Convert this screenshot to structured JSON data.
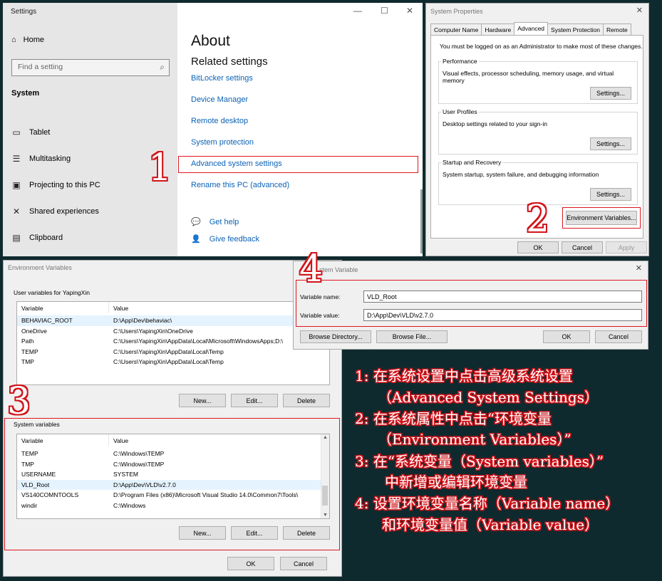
{
  "settings": {
    "window_title": "Settings",
    "home": "Home",
    "search_placeholder": "Find a setting",
    "section": "System",
    "nav": [
      "Tablet",
      "Multitasking",
      "Projecting to this PC",
      "Shared experiences",
      "Clipboard"
    ],
    "page_title": "About",
    "related_title": "Related settings",
    "links": [
      "BitLocker settings",
      "Device Manager",
      "Remote desktop",
      "System protection",
      "Advanced system settings",
      "Rename this PC (advanced)"
    ],
    "help": "Get help",
    "feedback": "Give feedback"
  },
  "system_properties": {
    "title": "System Properties",
    "tabs": [
      "Computer Name",
      "Hardware",
      "Advanced",
      "System Protection",
      "Remote"
    ],
    "active_tab": "Advanced",
    "note": "You must be logged on as an Administrator to make most of these changes.",
    "performance": {
      "title": "Performance",
      "desc": "Visual effects, processor scheduling, memory usage, and virtual memory",
      "button": "Settings..."
    },
    "user_profiles": {
      "title": "User Profiles",
      "desc": "Desktop settings related to your sign-in",
      "button": "Settings..."
    },
    "startup": {
      "title": "Startup and Recovery",
      "desc": "System startup, system failure, and debugging information",
      "button": "Settings..."
    },
    "env_button": "Environment Variables...",
    "ok": "OK",
    "cancel": "Cancel",
    "apply": "Apply"
  },
  "environment_variables": {
    "title": "Environment Variables",
    "user_label": "User variables for YapingXin",
    "col_variable": "Variable",
    "col_value": "Value",
    "user_vars": [
      {
        "name": "BEHAVIAC_ROOT",
        "value": "D:\\App\\Dev\\behaviac\\"
      },
      {
        "name": "OneDrive",
        "value": "C:\\Users\\YapingXin\\OneDrive"
      },
      {
        "name": "Path",
        "value": "C:\\Users\\YapingXin\\AppData\\Local\\Microsoft\\WindowsApps;D:\\"
      },
      {
        "name": "TEMP",
        "value": "C:\\Users\\YapingXin\\AppData\\Local\\Temp"
      },
      {
        "name": "TMP",
        "value": "C:\\Users\\YapingXin\\AppData\\Local\\Temp"
      }
    ],
    "system_label": "System variables",
    "system_vars": [
      {
        "name": "TEMP",
        "value": "C:\\Windows\\TEMP"
      },
      {
        "name": "TMP",
        "value": "C:\\Windows\\TEMP"
      },
      {
        "name": "USERNAME",
        "value": "SYSTEM"
      },
      {
        "name": "VLD_Root",
        "value": "D:\\App\\Dev\\VLD\\v2.7.0"
      },
      {
        "name": "VS140COMNTOOLS",
        "value": "D:\\Program Files (x86)\\Microsoft Visual Studio 14.0\\Common7\\Tools\\"
      },
      {
        "name": "windir",
        "value": "C:\\Windows"
      }
    ],
    "new": "New...",
    "edit": "Edit...",
    "delete": "Delete",
    "ok": "OK",
    "cancel": "Cancel"
  },
  "edit_variable": {
    "title_visible": "stem Variable",
    "name_label": "Variable name:",
    "name_value": "VLD_Root",
    "value_label": "Variable value:",
    "value_value": "D:\\App\\Dev\\VLD\\v2.7.0",
    "browse_dir": "Browse Directory...",
    "browse_file": "Browse File...",
    "ok": "OK",
    "cancel": "Cancel"
  },
  "step_numbers": [
    "1",
    "2",
    "3",
    "4"
  ],
  "instructions": [
    "1: 在系统设置中点击高级系统设置",
    "（Advanced System Settings）",
    "2: 在系统属性中点击“环境变量",
    "（Environment Variables）”",
    "3: 在“系统变量（System variables）”",
    "中新增或编辑环境变量",
    "4: 设置环境变量名称（Variable name）",
    "和环境变量值（Variable value）"
  ],
  "colors": {
    "highlight": "#e0161e",
    "link": "#0b62b5",
    "background": "#0f2a2e"
  }
}
